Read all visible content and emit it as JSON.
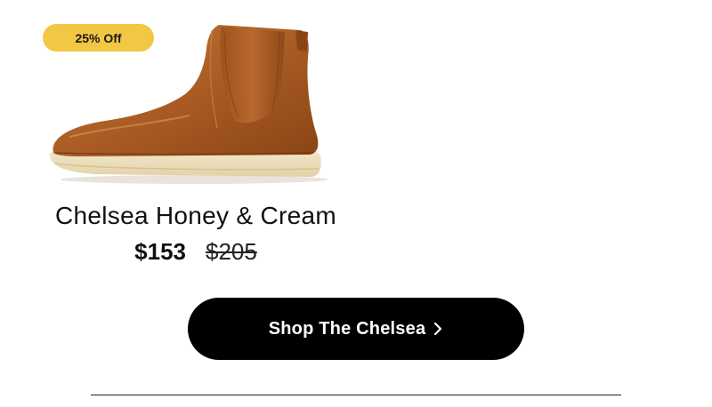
{
  "product": {
    "badge": "25% Off",
    "name": "Chelsea Honey & Cream",
    "price_current": "$153",
    "price_original": "$205",
    "image_icon": "chelsea-boot-image",
    "colors": {
      "badge_bg": "#f2c744",
      "leather": "#b0642a",
      "sole": "#efe3c4"
    }
  },
  "cta": {
    "label": "Shop The Chelsea",
    "icon": "chevron-right-icon",
    "bg": "#000000",
    "fg": "#ffffff"
  }
}
